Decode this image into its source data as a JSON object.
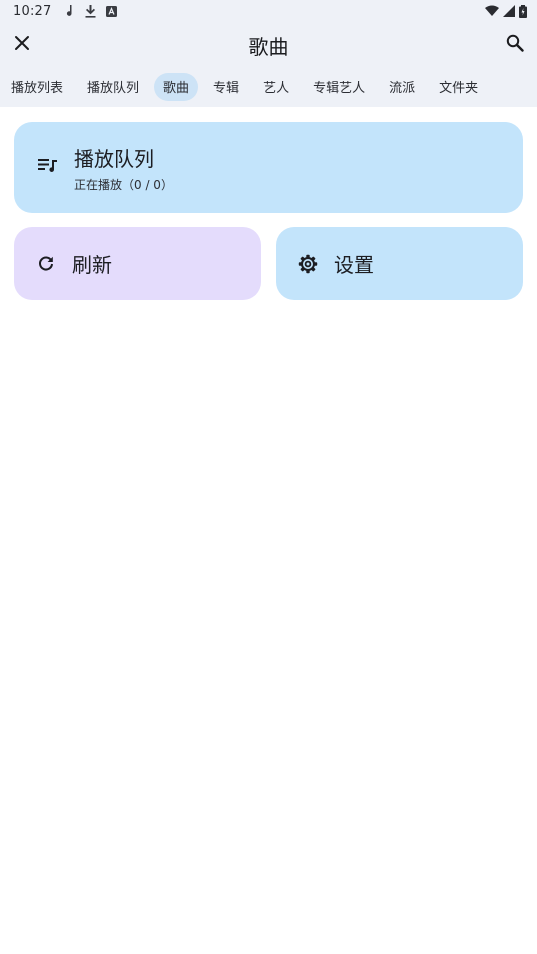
{
  "status_bar": {
    "time": "10:27"
  },
  "top_bar": {
    "title": "歌曲"
  },
  "tabs": [
    {
      "label": "播放列表",
      "active": false
    },
    {
      "label": "播放队列",
      "active": false
    },
    {
      "label": "歌曲",
      "active": true
    },
    {
      "label": "专辑",
      "active": false
    },
    {
      "label": "艺人",
      "active": false
    },
    {
      "label": "专辑艺人",
      "active": false
    },
    {
      "label": "流派",
      "active": false
    },
    {
      "label": "文件夹",
      "active": false
    }
  ],
  "cards": {
    "queue": {
      "title": "播放队列",
      "subtitle": "正在播放（0 / 0）",
      "icon": "queue-music-icon"
    },
    "refresh": {
      "title": "刷新",
      "icon": "refresh-icon"
    },
    "settings": {
      "title": "设置",
      "icon": "gear-icon"
    }
  },
  "colors": {
    "chrome_bg": "#eef1f7",
    "active_tab": "#cde3f6",
    "blue_card": "#c3e4fb",
    "purple_card": "#e4dcfc"
  }
}
